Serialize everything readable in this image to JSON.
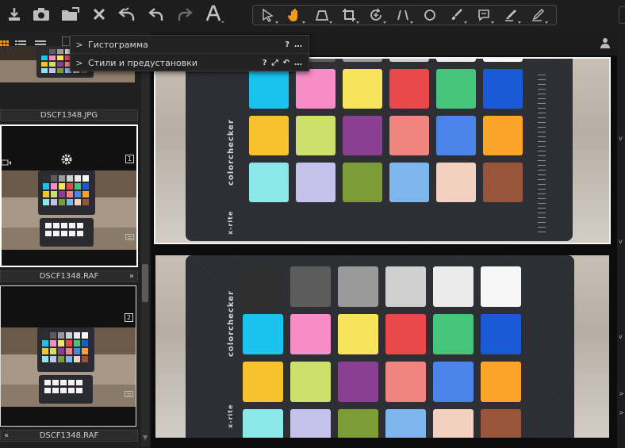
{
  "toolbar": {
    "left_buttons": [
      "import-icon",
      "camera-icon",
      "folder-export-icon",
      "delete-icon",
      "undo-history-icon",
      "undo-icon",
      "redo-icon",
      "text-tool-icon"
    ],
    "tools": [
      "select-pointer-icon",
      "pan-hand-icon",
      "keystone-icon",
      "crop-icon",
      "rotate-icon",
      "straighten-icon",
      "circle-mask-icon",
      "brush-icon",
      "annotation-icon",
      "eraser-icon",
      "pencil-icon"
    ],
    "active_tool": "pan-hand-icon",
    "accent_color": "#f29a1e"
  },
  "tools_panel": {
    "rows": [
      {
        "label": "Гистограмма",
        "actions": [
          "?",
          "…"
        ]
      },
      {
        "label": "Стили и предустановки",
        "actions": [
          "?",
          "⤢",
          "↶",
          "…"
        ]
      }
    ]
  },
  "browser": {
    "view_modes": [
      "grid-view-icon",
      "list-view-icon",
      "filmstrip-view-icon"
    ],
    "thumbnails": [
      {
        "filename": "DSCF1348.JPG",
        "selected": false,
        "badge": ""
      },
      {
        "filename": "DSCF1348.RAF",
        "selected": true,
        "badge": "1",
        "expand": "»"
      },
      {
        "filename": "DSCF1348.RAF",
        "selected": false,
        "badge": "2",
        "expand": "«"
      }
    ]
  },
  "viewer": {
    "variants": 2,
    "selected_variant": 1
  },
  "checker": {
    "brand_text": "colorchecker",
    "subbrand_text": "x-rite",
    "rows": [
      [
        "#2f2f2f",
        "#5c5c5c",
        "#9a9a9a",
        "#cfcfcf",
        "#ebebeb",
        "#f7f7f7"
      ],
      [
        "#19c3ee",
        "#f68cc8",
        "#f7e45a",
        "#e8484a",
        "#46c47a",
        "#1a5ad6"
      ],
      [
        "#f7c22e",
        "#cde06a",
        "#8a3f93",
        "#f08580",
        "#4a84e8",
        "#fba42a"
      ],
      [
        "#8ae8ea",
        "#c6c2ec",
        "#7c9c36",
        "#7db6ec",
        "#f3d1c1",
        "#99553a"
      ]
    ]
  }
}
